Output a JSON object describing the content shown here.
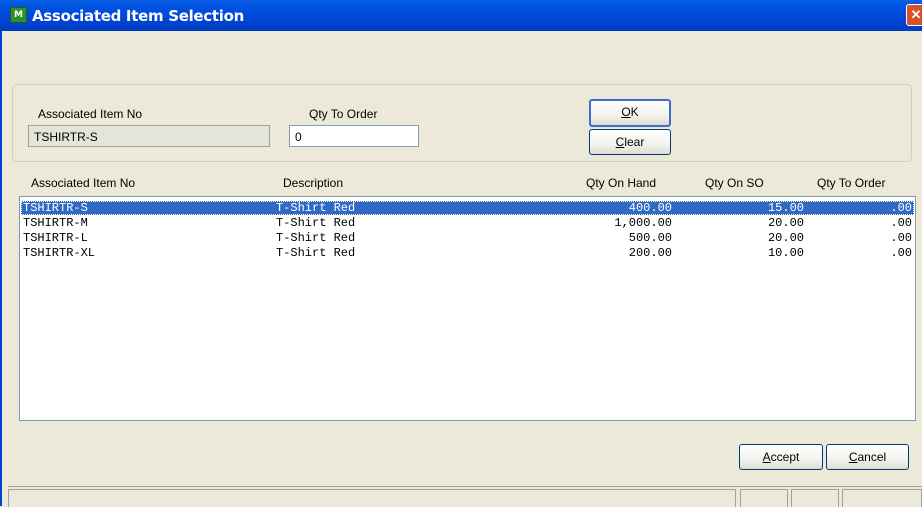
{
  "window": {
    "title": "Associated Item Selection",
    "icon": "app-icon",
    "close_glyph": "✕"
  },
  "header": {
    "item_no_label": "Associated Item No",
    "item_no_value": "TSHIRTR-S",
    "qty_label": "Qty To Order",
    "qty_value": "0"
  },
  "buttons": {
    "ok_label": "OK",
    "ok_accesskey": "O",
    "clear_label": "Clear",
    "clear_accesskey": "C",
    "accept_label": "Accept",
    "accept_accesskey": "A",
    "cancel_label": "Cancel",
    "cancel_accesskey": "C"
  },
  "grid": {
    "columns": [
      "Associated Item No",
      "Description",
      "Qty On Hand",
      "Qty On SO",
      "Qty To Order"
    ],
    "rows": [
      {
        "item": "TSHIRTR-S",
        "desc": "T-Shirt Red",
        "onhand": "400.00",
        "onso": "15.00",
        "order": ".00",
        "selected": true
      },
      {
        "item": "TSHIRTR-M",
        "desc": "T-Shirt Red",
        "onhand": "1,000.00",
        "onso": "20.00",
        "order": ".00",
        "selected": false
      },
      {
        "item": "TSHIRTR-L",
        "desc": "T-Shirt Red",
        "onhand": "500.00",
        "onso": "20.00",
        "order": ".00",
        "selected": false
      },
      {
        "item": "TSHIRTR-XL",
        "desc": "T-Shirt Red",
        "onhand": "200.00",
        "onso": "10.00",
        "order": ".00",
        "selected": false
      }
    ]
  },
  "colors": {
    "titlebar": "#0054e3",
    "dialog_bg": "#ece9d8",
    "selection": "#316ac5",
    "field_border": "#7f9db9"
  }
}
